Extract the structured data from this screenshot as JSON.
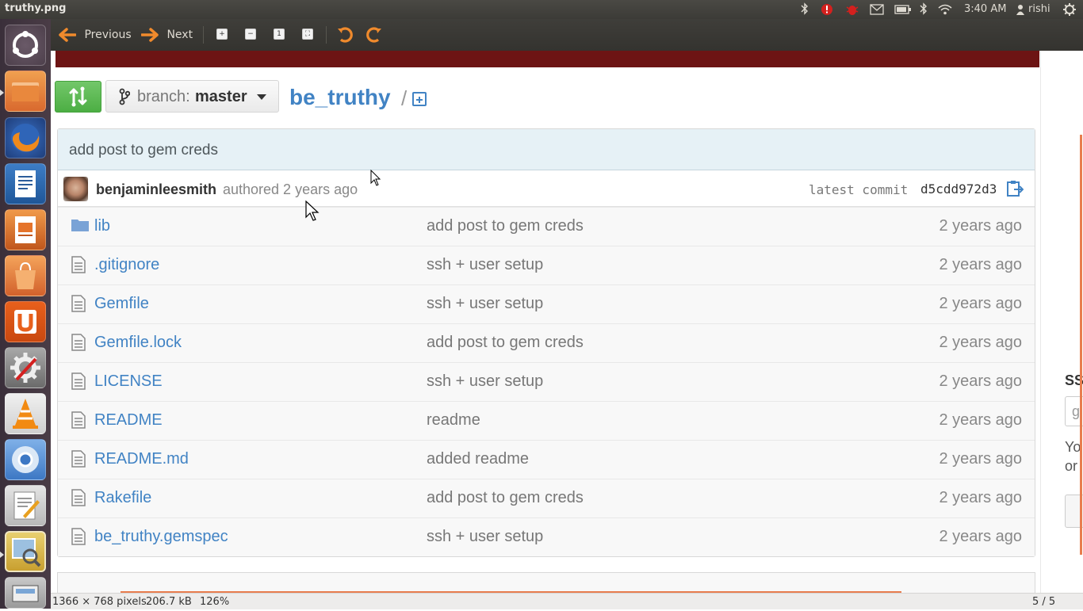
{
  "window_title": "truthy.png",
  "panel": {
    "time": "3:40 AM",
    "user": "rishi",
    "icons": [
      "bluetooth-icon",
      "bug-alert-icon",
      "bug-alert-icon",
      "mail-icon",
      "battery-icon",
      "bluetooth-icon",
      "wifi-icon",
      "user-icon",
      "power-gear-icon"
    ]
  },
  "toolbar": {
    "previous_label": "Previous",
    "next_label": "Next",
    "tools": [
      "zoom-in-icon",
      "zoom-out-icon",
      "normal-size-icon",
      "best-fit-icon",
      "rotate-left-icon",
      "rotate-right-icon"
    ]
  },
  "launcher": {
    "items": [
      "ubuntu-dash-icon",
      "files-icon",
      "firefox-icon",
      "writer-icon",
      "impress-icon",
      "software-center-icon",
      "ubuntu-one-icon",
      "system-settings-icon",
      "vlc-icon",
      "chromium-icon",
      "text-editor-icon",
      "image-viewer-icon",
      "scanner-icon"
    ]
  },
  "repo": {
    "branch_prefix": "branch:",
    "branch_name": "master",
    "name": "be_truthy",
    "slash": "/"
  },
  "commit": {
    "message": "add post to gem creds",
    "author": "benjaminleesmith",
    "authored_text": "authored 2 years ago",
    "latest_commit_label": "latest commit",
    "sha": "d5cdd972d3"
  },
  "files": [
    {
      "type": "folder",
      "name": "lib",
      "message": "add post to gem creds",
      "age": "2 years ago"
    },
    {
      "type": "file",
      "name": ".gitignore",
      "message": "ssh + user setup",
      "age": "2 years ago"
    },
    {
      "type": "file",
      "name": "Gemfile",
      "message": "ssh + user setup",
      "age": "2 years ago"
    },
    {
      "type": "file",
      "name": "Gemfile.lock",
      "message": "add post to gem creds",
      "age": "2 years ago"
    },
    {
      "type": "file",
      "name": "LICENSE",
      "message": "ssh + user setup",
      "age": "2 years ago"
    },
    {
      "type": "file",
      "name": "README",
      "message": "readme",
      "age": "2 years ago"
    },
    {
      "type": "file",
      "name": "README.md",
      "message": "added readme",
      "age": "2 years ago"
    },
    {
      "type": "file",
      "name": "Rakefile",
      "message": "add post to gem creds",
      "age": "2 years ago"
    },
    {
      "type": "file",
      "name": "be_truthy.gemspec",
      "message": "ssh + user setup",
      "age": "2 years ago"
    }
  ],
  "sidebar_fragments": {
    "heading": "SS",
    "input_text": "g",
    "line1": "Yo",
    "line2": "or"
  },
  "statusbar": {
    "dimensions": "1366 × 768 pixels",
    "size": "206.7 kB",
    "zoom": "126%",
    "page": "5 / 5"
  },
  "colors": {
    "link": "#4183c4",
    "accent_orange": "#e87d4e",
    "header_red": "#6d1414",
    "compare_green": "#55b24c"
  }
}
